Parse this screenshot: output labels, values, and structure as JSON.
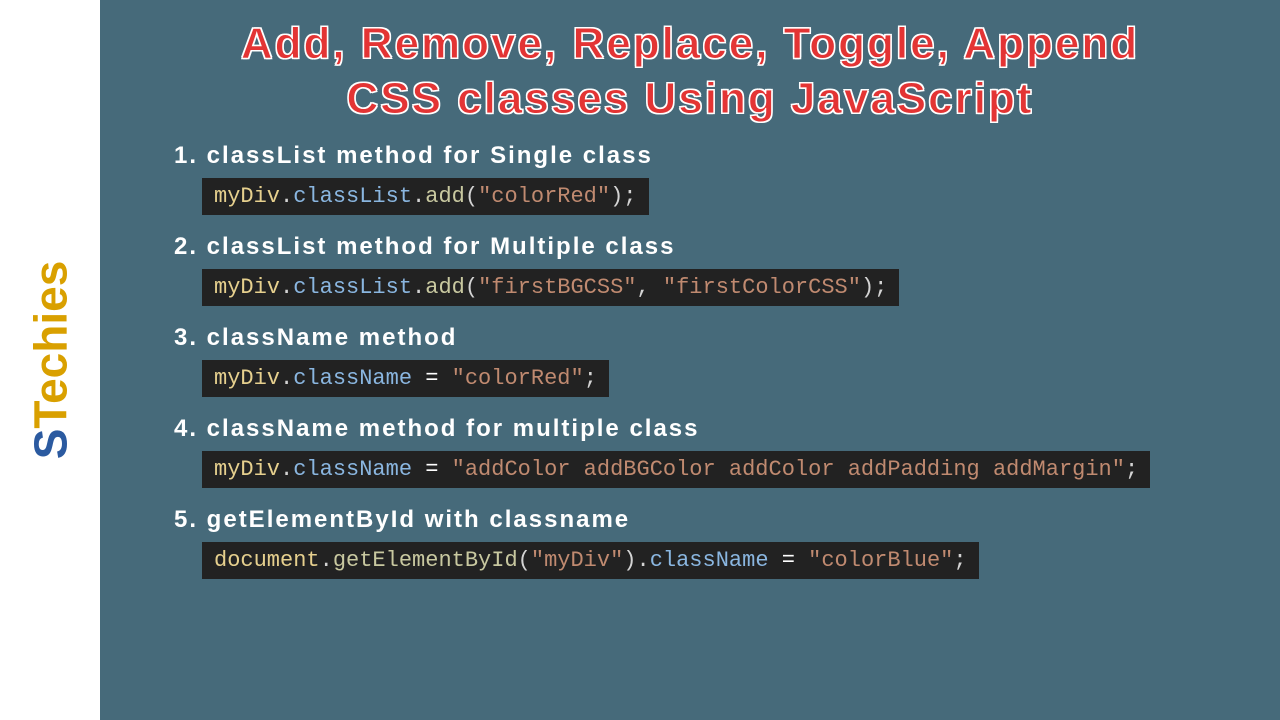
{
  "logo": {
    "part1": "S",
    "part2": "Tech",
    "part3": "ies"
  },
  "title": {
    "line1": "Add, Remove, Replace, Toggle, Append",
    "line2": "CSS classes Using JavaScript"
  },
  "items": [
    {
      "title": "1. classList method for Single class",
      "code": [
        {
          "t": "myDiv",
          "c": "c-var"
        },
        {
          "t": ".",
          "c": "c-op"
        },
        {
          "t": "classList",
          "c": "c-prop"
        },
        {
          "t": ".",
          "c": "c-op"
        },
        {
          "t": "add",
          "c": "c-fn"
        },
        {
          "t": "(",
          "c": "c-op"
        },
        {
          "t": "\"colorRed\"",
          "c": "c-str"
        },
        {
          "t": ");",
          "c": "c-op"
        }
      ]
    },
    {
      "title": "2. classList method for Multiple class",
      "code": [
        {
          "t": "myDiv",
          "c": "c-var"
        },
        {
          "t": ".",
          "c": "c-op"
        },
        {
          "t": "classList",
          "c": "c-prop"
        },
        {
          "t": ".",
          "c": "c-op"
        },
        {
          "t": "add",
          "c": "c-fn"
        },
        {
          "t": "(",
          "c": "c-op"
        },
        {
          "t": "\"firstBGCSS\"",
          "c": "c-str"
        },
        {
          "t": ", ",
          "c": "c-op"
        },
        {
          "t": "\"firstColorCSS\"",
          "c": "c-str"
        },
        {
          "t": ");",
          "c": "c-op"
        }
      ]
    },
    {
      "title": "3. className method",
      "code": [
        {
          "t": "myDiv",
          "c": "c-var"
        },
        {
          "t": ".",
          "c": "c-op"
        },
        {
          "t": "className",
          "c": "c-prop"
        },
        {
          "t": " = ",
          "c": "c-eq"
        },
        {
          "t": "\"colorRed\"",
          "c": "c-str"
        },
        {
          "t": ";",
          "c": "c-op"
        }
      ]
    },
    {
      "title": "4. className method for multiple class",
      "code": [
        {
          "t": "myDiv",
          "c": "c-var"
        },
        {
          "t": ".",
          "c": "c-op"
        },
        {
          "t": "className",
          "c": "c-prop"
        },
        {
          "t": " = ",
          "c": "c-eq"
        },
        {
          "t": "\"addColor addBGColor addColor addPadding addMargin\"",
          "c": "c-str"
        },
        {
          "t": ";",
          "c": "c-op"
        }
      ]
    },
    {
      "title": "5. getElementById with classname",
      "code": [
        {
          "t": "document",
          "c": "c-var"
        },
        {
          "t": ".",
          "c": "c-op"
        },
        {
          "t": "getElementById",
          "c": "c-fn"
        },
        {
          "t": "(",
          "c": "c-op"
        },
        {
          "t": "\"myDiv\"",
          "c": "c-str"
        },
        {
          "t": ")",
          "c": "c-op"
        },
        {
          "t": ".",
          "c": "c-op"
        },
        {
          "t": "className",
          "c": "c-prop"
        },
        {
          "t": " = ",
          "c": "c-eq"
        },
        {
          "t": "\"colorBlue\"",
          "c": "c-str"
        },
        {
          "t": ";",
          "c": "c-op"
        }
      ]
    }
  ]
}
